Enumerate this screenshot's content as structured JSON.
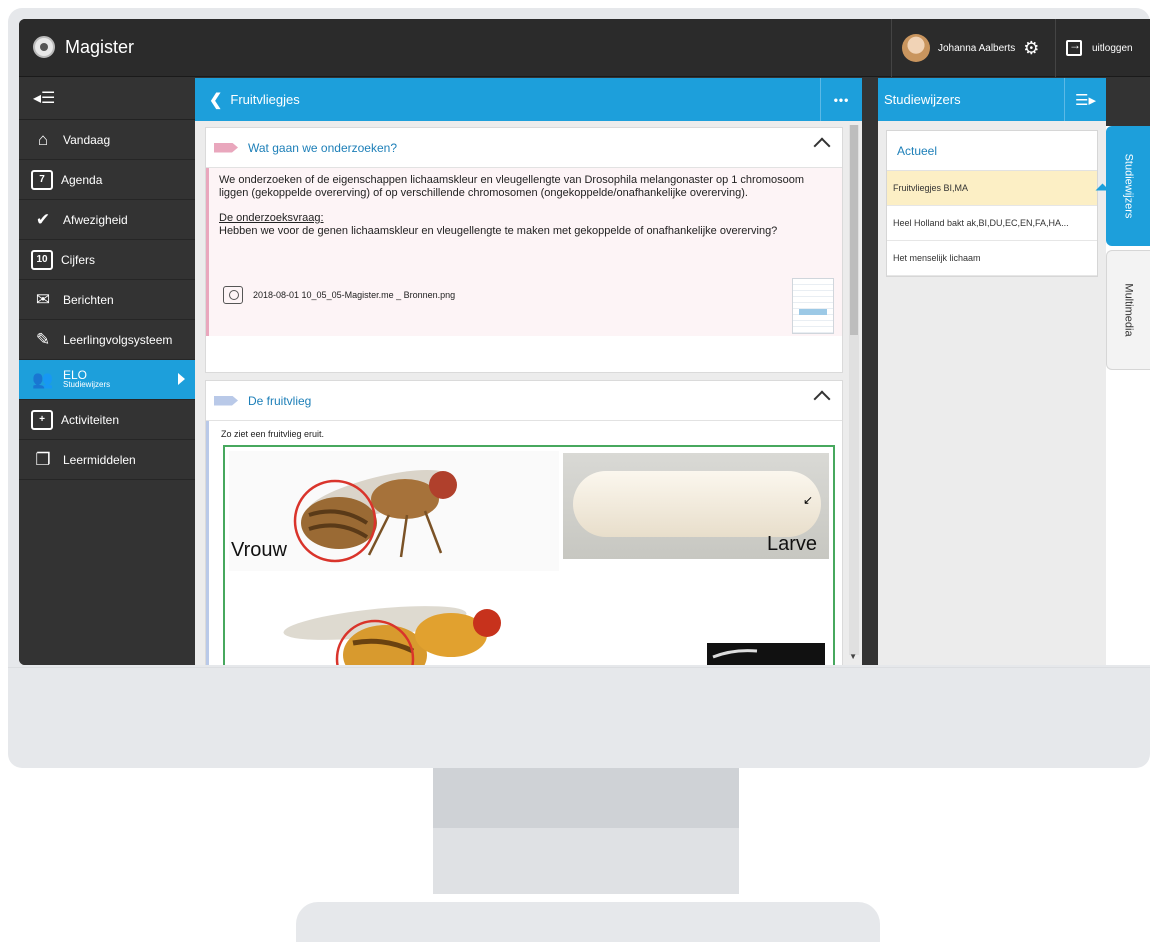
{
  "app": {
    "brand": "Magister"
  },
  "user": {
    "name": "Johanna Aalberts",
    "logout_label": "uitloggen"
  },
  "sidebar": {
    "items": [
      {
        "label": "Vandaag"
      },
      {
        "label": "Agenda",
        "badge": "7"
      },
      {
        "label": "Afwezigheid"
      },
      {
        "label": "Cijfers",
        "badge": "10"
      },
      {
        "label": "Berichten"
      },
      {
        "label": "Leerlingvolgsysteem"
      },
      {
        "label": "ELO",
        "sublabel": "Studiewijzers"
      },
      {
        "label": "Activiteiten"
      },
      {
        "label": "Leermiddelen"
      }
    ]
  },
  "main": {
    "title": "Fruitvliegjes",
    "section1": {
      "title": "Wat gaan we onderzoeken?",
      "paragraph": "We onderzoeken of de eigenschappen lichaamskleur en vleugellengte van Drosophila melangonaster op 1 chromosoom liggen (gekoppelde overerving) of op verschillende chromosomen (ongekoppelde/onafhankelijke overerving).",
      "question_heading": "De onderzoeksvraag:",
      "question": "Hebben we voor de genen lichaamskleur en vleugellengte te maken met gekoppelde of onafhankelijke overerving?",
      "attachment": "2018-08-01 10_05_05-Magister.me _ Bronnen.png"
    },
    "section2": {
      "title": "De fruitvlieg",
      "caption": "Zo ziet een fruitvlieg eruit.",
      "label_female": "Vrouw",
      "label_larva": "Larve"
    }
  },
  "right_panel": {
    "title": "Studiewijzers",
    "list_heading": "Actueel",
    "items": [
      {
        "label": "Fruitvliegjes BI,MA",
        "selected": true
      },
      {
        "label": "Heel Holland bakt ak,BI,DU,EC,EN,FA,HA...",
        "selected": false
      },
      {
        "label": "Het menselijk lichaam",
        "selected": false
      }
    ],
    "tabs": [
      "Studiewijzers",
      "Multimedia"
    ]
  },
  "colors": {
    "accent": "#1d9fdb",
    "sidebar": "#333333",
    "highlight": "#fcefc5",
    "tag_pink": "#e9a7bd",
    "tag_blue": "#b9c9e8"
  }
}
